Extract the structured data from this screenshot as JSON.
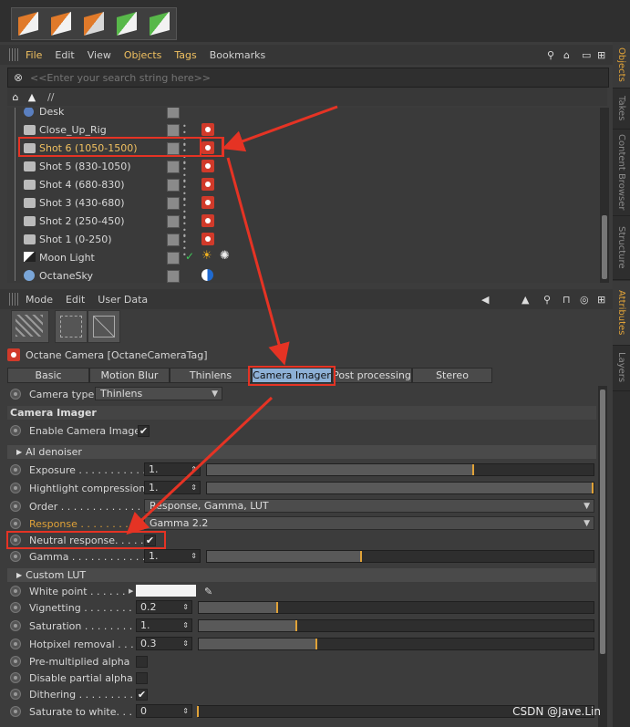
{
  "top_toolbar": {
    "icons": [
      "render-cube-icon",
      "render-view-icon",
      "render-settings-icon",
      "green-cube-icon",
      "green-cube-alt-icon"
    ]
  },
  "objects_menu": {
    "items": [
      "File",
      "Edit",
      "View",
      "Objects",
      "Tags",
      "Bookmarks"
    ]
  },
  "search": {
    "placeholder": "<<Enter your search string here>>"
  },
  "path": {
    "text": "//"
  },
  "objects": [
    {
      "name": "Desk",
      "type": "null"
    },
    {
      "name": "Close_Up_Rig",
      "type": "camera"
    },
    {
      "name": "Shot 6 (1050-1500)",
      "type": "camera",
      "selected": true
    },
    {
      "name": "Shot 5 (830-1050)",
      "type": "camera"
    },
    {
      "name": "Shot 4 (680-830)",
      "type": "camera"
    },
    {
      "name": "Shot 3 (430-680)",
      "type": "camera"
    },
    {
      "name": "Shot 2 (250-450)",
      "type": "camera"
    },
    {
      "name": "Shot 1 (0-250)",
      "type": "camera"
    },
    {
      "name": "Moon Light",
      "type": "light"
    },
    {
      "name": "OctaneSky",
      "type": "sky"
    }
  ],
  "side_tabs": [
    "Objects",
    "Takes",
    "Content Browser",
    "Structure",
    "Attributes",
    "Layers"
  ],
  "attr_menu": {
    "items": [
      "Mode",
      "Edit",
      "User Data"
    ]
  },
  "attr_title": "Octane Camera [OctaneCameraTag]",
  "tabs": [
    "Basic",
    "Motion Blur",
    "Thinlens",
    "Camera Imager",
    "Post processing",
    "Stereo"
  ],
  "camera_type": {
    "label": "Camera type",
    "value": "Thinlens"
  },
  "camera_imager": {
    "heading": "Camera Imager",
    "enable_label": "Enable Camera Imager",
    "enable_checked": "✔"
  },
  "ai_denoiser": {
    "label": "AI denoiser"
  },
  "params": {
    "exposure": {
      "label": "Exposure . . . . . . . . . . . .",
      "value": "1.",
      "fraction": 0.69
    },
    "highlight": {
      "label": "Hightlight compression",
      "value": "1.",
      "fraction": 1.0
    },
    "order": {
      "label": "Order . . . . . . . . . . . . . . .",
      "value": "Response, Gamma, LUT"
    },
    "response": {
      "label": "Response . . . . . . . . .",
      "value": "Gamma 2.2"
    },
    "neutral": {
      "label": "Neutral response. . . . . .",
      "checked": "✔"
    },
    "gamma": {
      "label": "Gamma . . . . . . . . . . . . .",
      "value": "1.",
      "fraction": 0.4
    }
  },
  "custom_lut": {
    "label": "Custom LUT"
  },
  "params2": {
    "white_point": {
      "label": "White point . . . . . ."
    },
    "vignetting": {
      "label": "Vignetting . . . . . . . . .",
      "value": "0.2",
      "fraction": 0.2
    },
    "saturation": {
      "label": "Saturation . . . . . . . . . .",
      "value": "1.",
      "fraction": 0.25
    },
    "hotpixel": {
      "label": "Hotpixel removal . . . .",
      "value": "0.3",
      "fraction": 0.3
    },
    "premult": {
      "label": "Pre-multiplied alpha"
    },
    "disable_partial": {
      "label": "Disable partial alpha"
    },
    "dithering": {
      "label": "Dithering . . . . . . . . . . .",
      "checked": "✔"
    },
    "saturate_white": {
      "label": "Saturate to white. . . .",
      "value": "0",
      "fraction": 0.0
    }
  },
  "watermark": "CSDN @Jave.Lin"
}
